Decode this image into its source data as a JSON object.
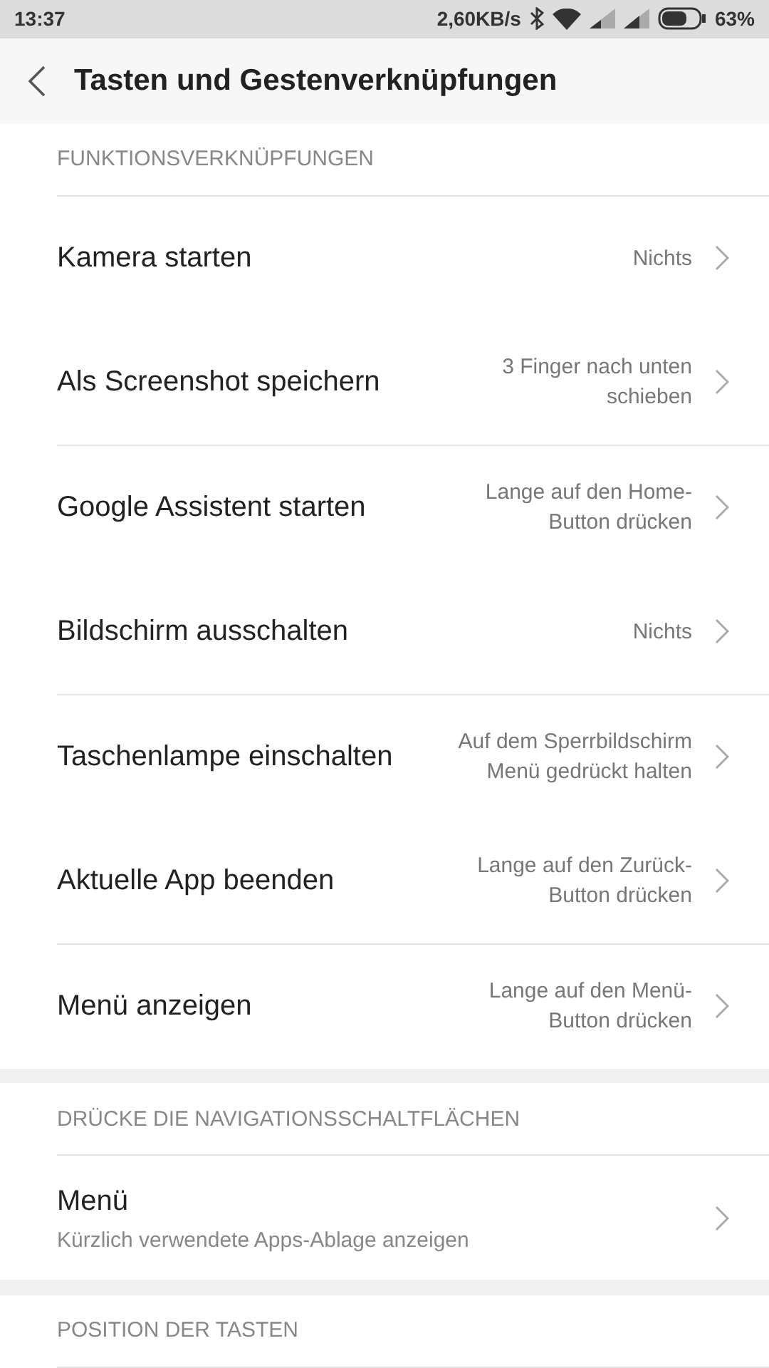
{
  "status_bar": {
    "time": "13:37",
    "speed": "2,60KB/s",
    "battery": "63%"
  },
  "header": {
    "title": "Tasten und Gestenverknüpfungen"
  },
  "sections": [
    {
      "title": "FUNKTIONSVERKNÜPFUNGEN",
      "items": [
        {
          "label": "Kamera starten",
          "value": "Nichts"
        },
        {
          "label": "Als Screenshot speichern",
          "value": "3 Finger nach unten schieben"
        },
        {
          "label": "Google Assistent starten",
          "value": "Lange auf den Home-Button drücken"
        },
        {
          "label": "Bildschirm ausschalten",
          "value": "Nichts"
        },
        {
          "label": "Taschenlampe einschalten",
          "value": "Auf dem Sperrbildschirm Menü gedrückt halten"
        },
        {
          "label": "Aktuelle App beenden",
          "value": "Lange auf den Zurück-Button drücken"
        },
        {
          "label": "Menü anzeigen",
          "value": "Lange auf den Menü-Button drücken"
        }
      ]
    },
    {
      "title": "DRÜCKE DIE NAVIGATIONSSCHALTFLÄCHEN",
      "items": [
        {
          "label": "Menü",
          "subtitle": "Kürzlich verwendete Apps-Ablage anzeigen"
        }
      ]
    },
    {
      "title": "POSITION DER TASTEN"
    }
  ]
}
